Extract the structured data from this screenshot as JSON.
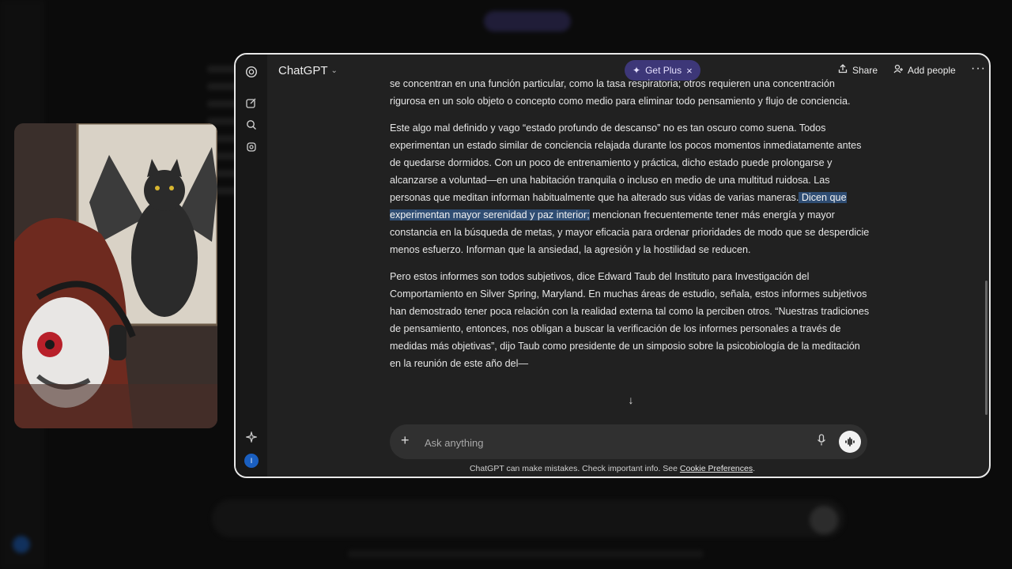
{
  "app": {
    "title": "ChatGPT"
  },
  "header": {
    "get_plus_label": "Get Plus",
    "share_label": "Share",
    "add_people_label": "Add people"
  },
  "rail": {
    "avatar_initial": "I"
  },
  "conversation": {
    "p0_line": "se concentran en una función particular, como la tasa respiratoria; otros requieren una concentración rigurosa en un solo objeto o concepto como medio para eliminar todo pensamiento y flujo de conciencia.",
    "p1_before": "Este algo mal definido y vago “estado profundo de descanso” no es tan oscuro como suena. Todos experimentan un estado similar de conciencia relajada durante los pocos momentos inmediatamente antes de quedarse dormidos. Con un poco de entrenamiento y práctica, dicho estado puede prolongarse y alcanzarse a voluntad—en una habitación tranquila o incluso en medio de una multitud ruidosa. Las personas que meditan informan habitualmente que ha alterado sus vidas de varias maneras.",
    "p1_highlight": " Dicen que experimentan mayor serenidad y paz interior;",
    "p1_after": " mencionan frecuentemente tener más energía y mayor constancia en la búsqueda de metas, y mayor eficacia para ordenar prioridades de modo que se desperdicie menos esfuerzo. Informan que la ansiedad, la agresión y la hostilidad se reducen.",
    "p2": "Pero estos informes son todos subjetivos, dice Edward Taub del Instituto para Investigación del Comportamiento en Silver Spring, Maryland. En muchas áreas de estudio, señala, estos informes subjetivos han demostrado tener poca relación con la realidad externa tal como la perciben otros. “Nuestras tradiciones de pensamiento, entonces, nos obligan a buscar la verificación de los informes personales a través de medidas más objetivas”, dijo Taub como presidente de un simposio sobre la psicobiología de la meditación en la reunión de este año del—"
  },
  "composer": {
    "placeholder": "Ask anything"
  },
  "footer": {
    "disclaimer": "ChatGPT can make mistakes. Check important info. See ",
    "link": "Cookie Preferences",
    "end": "."
  },
  "colors": {
    "accent_plus": "#3d3778",
    "highlight": "#2f4d73",
    "avatar": "#1a5fc0"
  }
}
